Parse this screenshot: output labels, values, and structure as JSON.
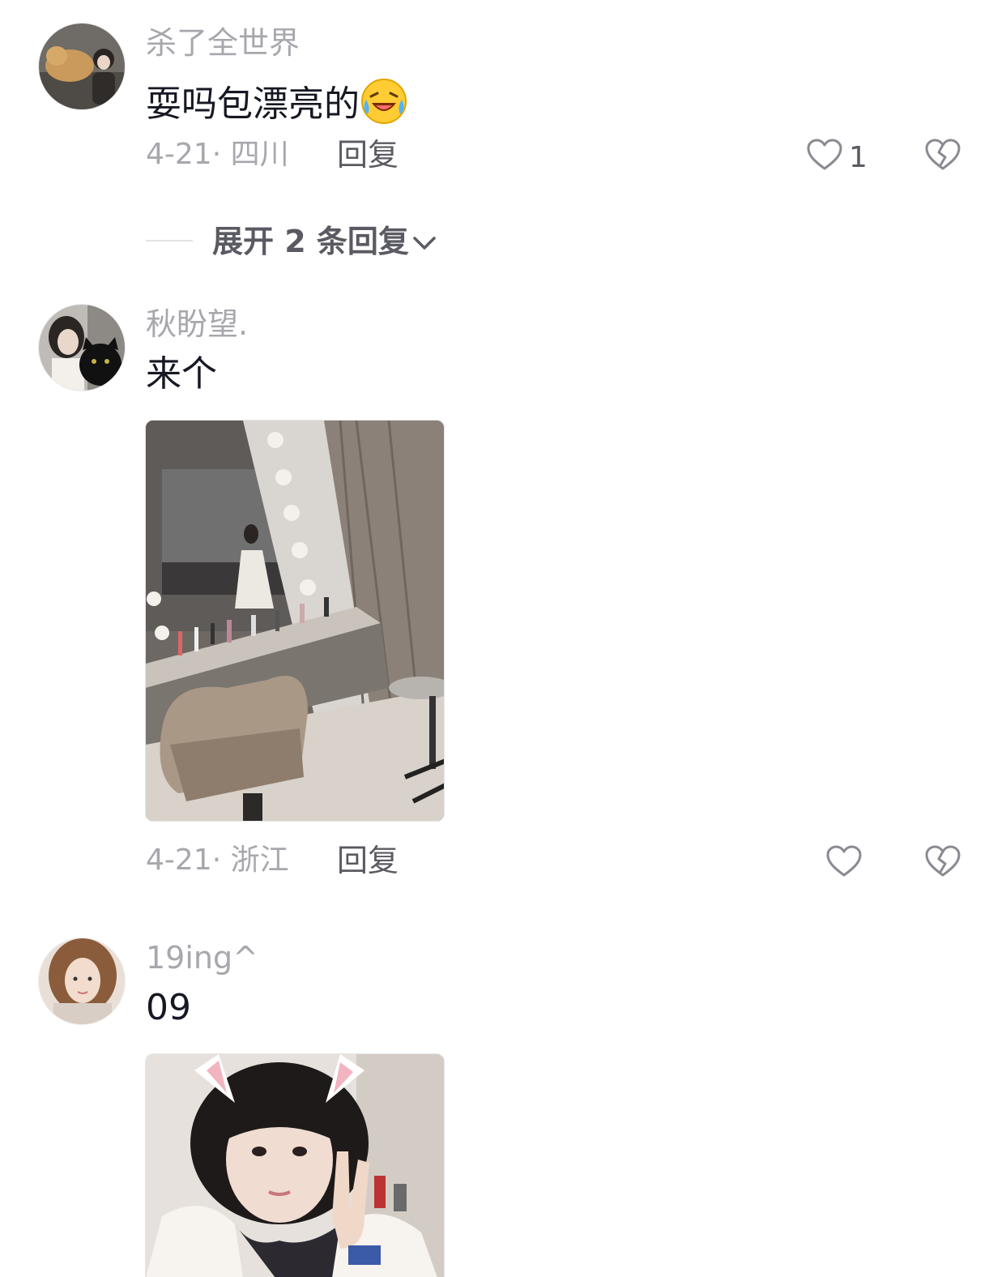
{
  "comments": [
    {
      "username": "杀了全世界",
      "text": "耍吗包漂亮的",
      "emoji": "laughing-crying-face-icon",
      "meta": "4-21· 四川",
      "reply_label": "回复",
      "like_count": "1",
      "expand_label": "展开 2 条回复"
    },
    {
      "username": "秋盼望.",
      "text": "来个",
      "meta": "4-21· 浙江",
      "reply_label": "回复",
      "like_count": ""
    },
    {
      "username": "19ing^",
      "text": "09"
    }
  ],
  "icons": {
    "like": "heart-outline-icon",
    "dislike": "broken-heart-icon",
    "expand": "chevron-down-icon"
  },
  "colors": {
    "username": "#a7a7ad",
    "text": "#161823",
    "secondary": "#5a5a62"
  }
}
